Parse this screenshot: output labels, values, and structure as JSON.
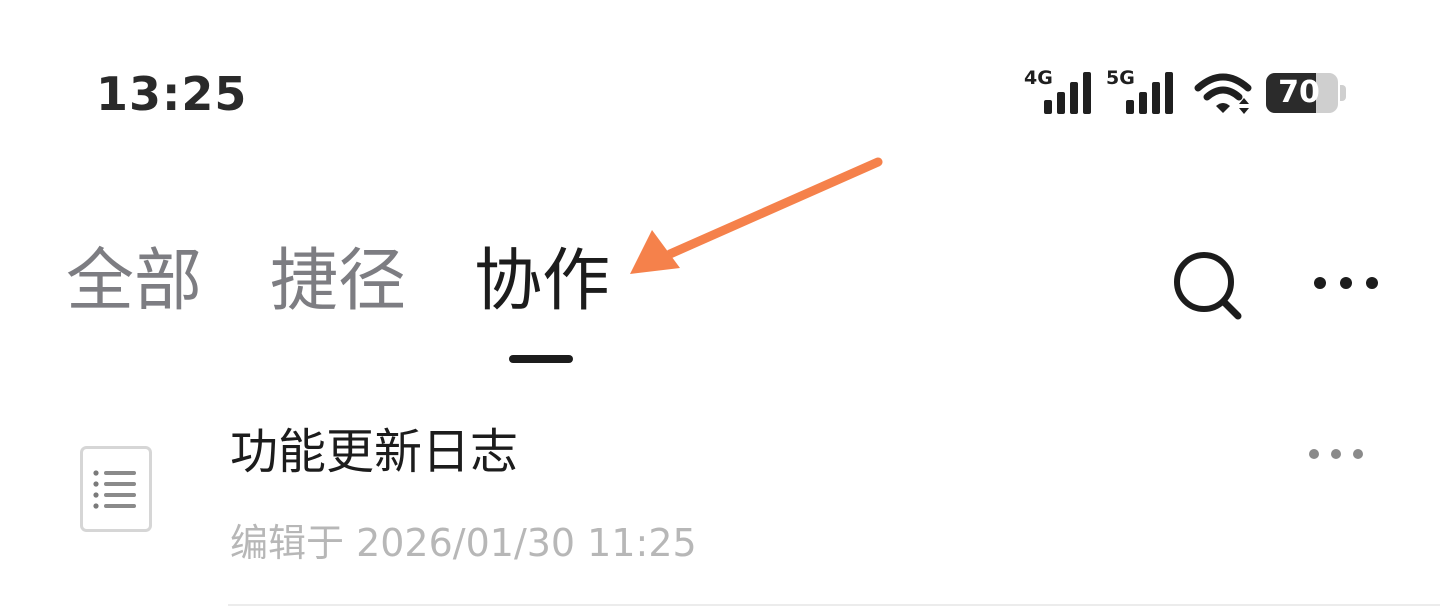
{
  "status_bar": {
    "time": "13:25",
    "network_1": "4G",
    "network_2": "5G",
    "battery_level": 70,
    "battery_label": "70",
    "icons": [
      "signal-bars-icon",
      "wifi-icon",
      "battery-icon"
    ]
  },
  "tabs": [
    {
      "label": "全部",
      "active": false
    },
    {
      "label": "捷径",
      "active": false
    },
    {
      "label": "协作",
      "active": true
    }
  ],
  "header_actions": {
    "search_icon": "search-icon",
    "more_icon": "more-horizontal-icon"
  },
  "annotation": {
    "icon": "arrow-annotation-icon",
    "color": "#f5814b"
  },
  "documents": [
    {
      "title": "功能更新日志",
      "meta": "编辑于 2026/01/30 11:25",
      "icon": "document-list-icon",
      "more_icon": "more-horizontal-icon"
    }
  ],
  "colors": {
    "tab_inactive": "#7d7d82",
    "tab_active": "#1c1c1c",
    "meta_text": "#b7b7b7",
    "accent_arrow": "#f5814b"
  }
}
